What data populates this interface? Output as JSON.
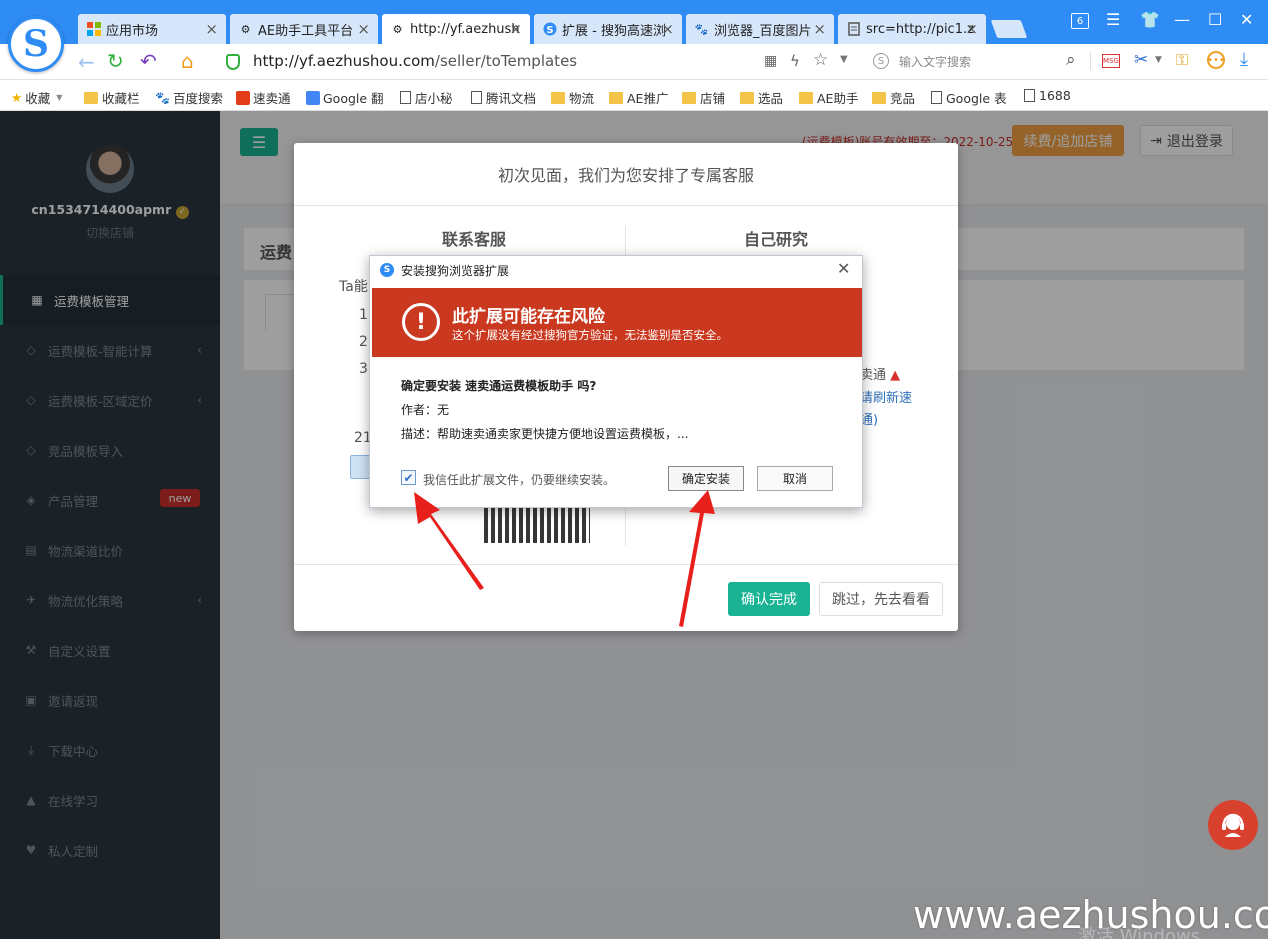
{
  "tabs": [
    {
      "label": "应用市场",
      "icon": "app-grid-icon"
    },
    {
      "label": "AE助手工具平台",
      "icon": "gear-icon"
    },
    {
      "label": "http://yf.aezhush",
      "icon": "gear-icon",
      "active": true
    },
    {
      "label": "扩展 - 搜狗高速浏",
      "icon": "sogou-icon"
    },
    {
      "label": "浏览器_百度图片",
      "icon": "baidu-paw-icon"
    },
    {
      "label": "src=http://pic1.z",
      "icon": "document-icon"
    }
  ],
  "window": {
    "tab_count": "6"
  },
  "addressbar": {
    "url_host": "http://yf.aezhushou.com",
    "url_path": "/seller/toTemplates",
    "search_placeholder": "输入文字搜索"
  },
  "bookmarks": [
    "收藏",
    "收藏栏",
    "百度搜索",
    "速卖通",
    "Google 翻",
    "店小秘",
    "腾讯文档",
    "物流",
    "AE推广",
    "店铺",
    "选品",
    "AE助手",
    "竞品",
    "Google 表",
    "1688"
  ],
  "sidebar": {
    "username": "cn1534714400apmr",
    "switch_store": "切换店铺",
    "items": [
      {
        "label": "运费模板管理",
        "icon": "table-icon",
        "active": true
      },
      {
        "label": "运费模板-智能计算",
        "icon": "diamond-icon",
        "chevron": true
      },
      {
        "label": "运费模板-区域定价",
        "icon": "diamond-icon",
        "chevron": true
      },
      {
        "label": "竞品模板导入",
        "icon": "diamond-icon"
      },
      {
        "label": "产品管理",
        "icon": "cube-icon",
        "badge": "new"
      },
      {
        "label": "物流渠道比价",
        "icon": "calculator-icon"
      },
      {
        "label": "物流优化策略",
        "icon": "plane-icon",
        "chevron": true
      },
      {
        "label": "自定义设置",
        "icon": "wrench-icon"
      },
      {
        "label": "邀请返现",
        "icon": "money-icon"
      },
      {
        "label": "下载中心",
        "icon": "download-icon"
      },
      {
        "label": "在线学习",
        "icon": "graduation-cap-icon"
      },
      {
        "label": "私人定制",
        "icon": "heart-icon"
      }
    ]
  },
  "header": {
    "expiry_text": "(运费模板)账号有效期至：2022-10-25",
    "renew_label": "续费/追加店铺",
    "logout_label": "退出登录"
  },
  "content": {
    "section_title": "运费"
  },
  "modal": {
    "title": "初次见面，我们为您安排了专属客服",
    "left_heading": "联系客服",
    "right_heading": "自己研究",
    "left_fragments": [
      "Ta能",
      "1.",
      "2.",
      "3.",
      "21"
    ],
    "right_fragments": [
      "卖通",
      "请刷新速",
      "通)"
    ],
    "confirm_label": "确认完成",
    "skip_label": "跳过，先去看看"
  },
  "ext_dialog": {
    "title": "安装搜狗浏览器扩展",
    "warning_title": "此扩展可能存在风险",
    "warning_sub": "这个扩展没有经过搜狗官方验证，无法鉴别是否安全。",
    "question": "确定要安装 速卖通运费模板助手 吗?",
    "author": "作者：无",
    "description": "描述：帮助速卖通卖家更快捷方便地设置运费模板，...",
    "trust_label": "我信任此扩展文件，仍要继续安装。",
    "trust_checked": true,
    "install_label": "确定安装",
    "cancel_label": "取消"
  },
  "watermark": "www.aezhushou.com",
  "os_watermark": "激活 Windows",
  "colors": {
    "browser_blue": "#2f8cf5",
    "sidebar_bg": "#2a3640",
    "accent_green": "#1ab394",
    "warning_red": "#c9381f",
    "renew_orange": "#f0a044"
  }
}
